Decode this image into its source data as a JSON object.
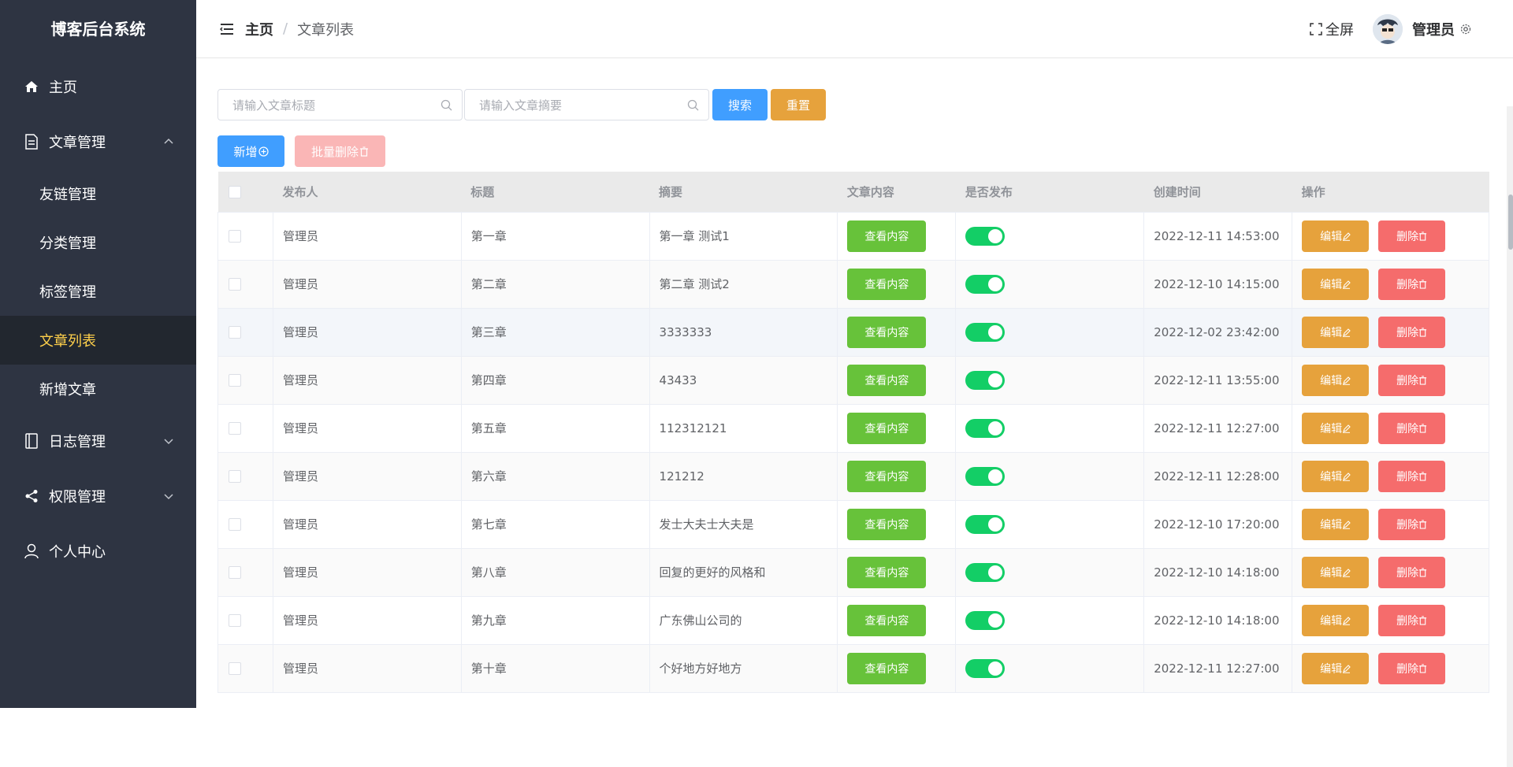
{
  "app": {
    "title": "博客后台系统"
  },
  "sidebar": {
    "items": [
      {
        "label": "主页",
        "icon": "home-icon"
      },
      {
        "label": "文章管理",
        "icon": "document-icon",
        "expanded": true,
        "children": [
          "友链管理",
          "分类管理",
          "标签管理",
          "文章列表",
          "新增文章"
        ]
      },
      {
        "label": "日志管理",
        "icon": "notebook-icon",
        "expanded": false
      },
      {
        "label": "权限管理",
        "icon": "share-icon",
        "expanded": false
      },
      {
        "label": "个人中心",
        "icon": "user-icon"
      }
    ],
    "active_child": "文章列表",
    "colors": {
      "bg": "#2e3442",
      "active_bg": "#22272f",
      "active_text": "#ffd04b"
    }
  },
  "header": {
    "breadcrumb": {
      "home": "主页",
      "separator": "/",
      "current": "文章列表"
    },
    "fullscreen_label": "全屏",
    "user_name": "管理员"
  },
  "search": {
    "title_placeholder": "请输入文章标题",
    "summary_placeholder": "请输入文章摘要",
    "search_label": "搜索",
    "reset_label": "重置"
  },
  "actions": {
    "add_label": "新增",
    "batch_delete_label": "批量删除"
  },
  "table": {
    "headers": [
      "发布人",
      "标题",
      "摘要",
      "文章内容",
      "是否发布",
      "创建时间",
      "操作"
    ],
    "view_label": "查看内容",
    "edit_label": "编辑",
    "delete_label": "删除",
    "rows": [
      {
        "author": "管理员",
        "title": "第一章",
        "summary": "第一章 测试1",
        "published": true,
        "created": "2022-12-11 14:53:00"
      },
      {
        "author": "管理员",
        "title": "第二章",
        "summary": "第二章 测试2",
        "published": true,
        "created": "2022-12-10 14:15:00"
      },
      {
        "author": "管理员",
        "title": "第三章",
        "summary": "3333333",
        "published": true,
        "created": "2022-12-02 23:42:00"
      },
      {
        "author": "管理员",
        "title": "第四章",
        "summary": "43433",
        "published": true,
        "created": "2022-12-11 13:55:00"
      },
      {
        "author": "管理员",
        "title": "第五章",
        "summary": "112312121",
        "published": true,
        "created": "2022-12-11 12:27:00"
      },
      {
        "author": "管理员",
        "title": "第六章",
        "summary": "121212",
        "published": true,
        "created": "2022-12-11 12:28:00"
      },
      {
        "author": "管理员",
        "title": "第七章",
        "summary": "发士大夫士大夫是",
        "published": true,
        "created": "2022-12-10 17:20:00"
      },
      {
        "author": "管理员",
        "title": "第八章",
        "summary": "回复的更好的风格和",
        "published": true,
        "created": "2022-12-10 14:18:00"
      },
      {
        "author": "管理员",
        "title": "第九章",
        "summary": "广东佛山公司的",
        "published": true,
        "created": "2022-12-10 14:18:00"
      },
      {
        "author": "管理员",
        "title": "第十章",
        "summary": "个好地方好地方",
        "published": true,
        "created": "2022-12-11 12:27:00"
      }
    ]
  },
  "colors": {
    "primary": "#409eff",
    "warning": "#e6a23c",
    "success": "#67c23a",
    "danger": "#f56c6c",
    "danger_light": "#fab6b6",
    "switch_on": "#13ce66"
  }
}
